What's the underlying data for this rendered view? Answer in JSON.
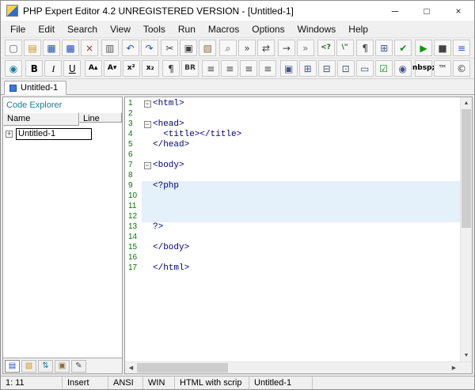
{
  "window": {
    "title": "PHP Expert Editor 4.2 UNREGISTERED VERSION - [Untitled-1]",
    "controls": {
      "minimize": "─",
      "maximize": "□",
      "close": "×"
    }
  },
  "menu": {
    "items": [
      "File",
      "Edit",
      "Search",
      "View",
      "Tools",
      "Run",
      "Macros",
      "Options",
      "Windows",
      "Help"
    ]
  },
  "toolbar_main": {
    "icons": [
      {
        "name": "new-file",
        "glyph": "▢",
        "color": "#555555"
      },
      {
        "name": "open-folder",
        "glyph": "▤",
        "color": "#c8921a"
      },
      {
        "name": "save",
        "glyph": "▦",
        "color": "#2050c0"
      },
      {
        "name": "save-all",
        "glyph": "▩",
        "color": "#2050c0"
      },
      {
        "name": "close-file",
        "glyph": "×",
        "color": "#883333"
      },
      {
        "type": "sep"
      },
      {
        "name": "print",
        "glyph": "▥",
        "color": "#555555"
      },
      {
        "type": "sep"
      },
      {
        "name": "undo",
        "glyph": "↶",
        "color": "#2050c0"
      },
      {
        "name": "redo",
        "glyph": "↷",
        "color": "#2050c0"
      },
      {
        "type": "sep"
      },
      {
        "name": "cut",
        "glyph": "✂",
        "color": "#444444"
      },
      {
        "name": "copy",
        "glyph": "▣",
        "color": "#444444"
      },
      {
        "name": "paste",
        "glyph": "▧",
        "color": "#8a6d3b"
      },
      {
        "type": "sep"
      },
      {
        "name": "find",
        "glyph": "⌕",
        "color": "#444444"
      },
      {
        "name": "find-next",
        "glyph": "»",
        "color": "#444444"
      },
      {
        "name": "replace",
        "glyph": "⇄",
        "color": "#444444"
      },
      {
        "type": "sep"
      },
      {
        "name": "goto-line",
        "glyph": "→",
        "color": "#444444"
      },
      {
        "name": "more-commands",
        "glyph": "»",
        "color": "#777777"
      },
      {
        "type": "sep"
      },
      {
        "name": "php-open-tag",
        "glyph": "<?",
        "color": "#206020",
        "small": true
      },
      {
        "name": "escape-quote",
        "glyph": "\\\"",
        "color": "#206020",
        "small": true
      },
      {
        "type": "sep"
      },
      {
        "name": "special-chars",
        "glyph": "¶",
        "color": "#444444"
      },
      {
        "name": "insert-table",
        "glyph": "⊞",
        "color": "#445588"
      },
      {
        "name": "check-syntax",
        "glyph": "✔",
        "color": "#1a8a1a"
      },
      {
        "type": "sep"
      },
      {
        "name": "run-script",
        "glyph": "▶",
        "color": "#0a9a0a"
      },
      {
        "name": "stop-script",
        "glyph": "■",
        "color": "#444444"
      },
      {
        "name": "script-output",
        "glyph": "≡",
        "color": "#2050c0"
      }
    ]
  },
  "toolbar_format": {
    "icons": [
      {
        "name": "preview-browser",
        "glyph": "◉",
        "color": "#17809c"
      },
      {
        "type": "sep"
      },
      {
        "name": "bold",
        "glyph": "B",
        "color": "#000000",
        "bold": true
      },
      {
        "name": "italic",
        "glyph": "I",
        "color": "#000000",
        "italic": true
      },
      {
        "name": "underline",
        "glyph": "U",
        "color": "#000000",
        "underline": true
      },
      {
        "type": "sep"
      },
      {
        "name": "font-bigger",
        "glyph": "A▴",
        "color": "#000000",
        "small": true
      },
      {
        "name": "font-smaller",
        "glyph": "A▾",
        "color": "#000000",
        "small": true
      },
      {
        "name": "superscript",
        "glyph": "x²",
        "color": "#000000",
        "small": true
      },
      {
        "name": "subscript",
        "glyph": "x₂",
        "color": "#000000",
        "small": true
      },
      {
        "type": "sep"
      },
      {
        "name": "pilcrow",
        "glyph": "¶",
        "color": "#333333"
      },
      {
        "name": "line-break",
        "glyph": "BR",
        "color": "#333333",
        "small": true
      },
      {
        "type": "sep"
      },
      {
        "name": "align-left",
        "glyph": "≡",
        "color": "#444444"
      },
      {
        "name": "align-center",
        "glyph": "≡",
        "color": "#444444"
      },
      {
        "name": "align-right",
        "glyph": "≡",
        "color": "#444444"
      },
      {
        "name": "align-justify",
        "glyph": "≡",
        "color": "#444444"
      },
      {
        "type": "sep"
      },
      {
        "name": "insert-image",
        "glyph": "▣",
        "color": "#445588"
      },
      {
        "name": "table",
        "glyph": "⊞",
        "color": "#445588"
      },
      {
        "name": "table-row",
        "glyph": "⊟",
        "color": "#445588"
      },
      {
        "name": "table-cell",
        "glyph": "⊡",
        "color": "#445588"
      },
      {
        "name": "form",
        "glyph": "▭",
        "color": "#445588"
      },
      {
        "name": "checkbox",
        "glyph": "☑",
        "color": "#1a8a1a"
      },
      {
        "name": "radio-button",
        "glyph": "◉",
        "color": "#445588"
      },
      {
        "type": "sep"
      },
      {
        "name": "nbsp-entity",
        "glyph": "nbsp;",
        "color": "#000000",
        "small": true
      },
      {
        "name": "trademark-entity",
        "glyph": "™",
        "color": "#333333"
      },
      {
        "name": "copyright-entity",
        "glyph": "©",
        "color": "#333333"
      }
    ]
  },
  "tabbar": {
    "tabs": [
      {
        "label": "Untitled-1"
      }
    ]
  },
  "code_explorer": {
    "title": "Code Explorer",
    "columns": [
      "Name",
      "Line"
    ],
    "expander_glyph": "+",
    "rows": [
      {
        "name": "Untitled-1",
        "line": ""
      }
    ]
  },
  "left_panel_tabs": {
    "icons": [
      {
        "name": "code-explorer-panel",
        "glyph": "▤",
        "color": "#2050c0",
        "active": true
      },
      {
        "name": "file-browser-panel",
        "glyph": "▧",
        "color": "#c8921a"
      },
      {
        "name": "ftp-panel",
        "glyph": "⇅",
        "color": "#17809c"
      },
      {
        "name": "snippets-panel",
        "glyph": "▣",
        "color": "#8a6d3b"
      },
      {
        "name": "todo-panel",
        "glyph": "✎",
        "color": "#444444"
      }
    ]
  },
  "editor": {
    "fold_glyph": "−",
    "colors": {
      "tag": "#000080",
      "line_number": "#007a00",
      "highlight": "#e4f0fa"
    },
    "lines": [
      {
        "n": "1",
        "text": "<html>",
        "fold": true,
        "hl": false
      },
      {
        "n": "2",
        "text": "",
        "fold": false,
        "hl": false
      },
      {
        "n": "3",
        "text": "<head>",
        "fold": true,
        "hl": false
      },
      {
        "n": "4",
        "text": "  <title></title>",
        "fold": false,
        "hl": false
      },
      {
        "n": "5",
        "text": "</head>",
        "fold": false,
        "hl": false
      },
      {
        "n": "6",
        "text": "",
        "fold": false,
        "hl": false
      },
      {
        "n": "7",
        "text": "<body>",
        "fold": true,
        "hl": false
      },
      {
        "n": "8",
        "text": "",
        "fold": false,
        "hl": false
      },
      {
        "n": "9",
        "text": "<?php",
        "fold": false,
        "hl": true
      },
      {
        "n": "10",
        "text": "",
        "fold": false,
        "hl": true
      },
      {
        "n": "11",
        "text": "",
        "fold": false,
        "hl": true
      },
      {
        "n": "12",
        "text": "",
        "fold": false,
        "hl": true
      },
      {
        "n": "13",
        "text": "?>",
        "fold": false,
        "hl": false
      },
      {
        "n": "14",
        "text": "",
        "fold": false,
        "hl": false
      },
      {
        "n": "15",
        "text": "</body>",
        "fold": false,
        "hl": false
      },
      {
        "n": "16",
        "text": "",
        "fold": false,
        "hl": false
      },
      {
        "n": "17",
        "text": "</html>",
        "fold": false,
        "hl": false
      }
    ]
  },
  "scrollbars": {
    "up": "▲",
    "down": "▼",
    "left": "◀",
    "right": "▶"
  },
  "status_bar": {
    "cells": [
      {
        "name": "caret-position",
        "text": "1: 11"
      },
      {
        "name": "insert-mode",
        "text": "Insert"
      },
      {
        "name": "encoding",
        "text": "ANSI"
      },
      {
        "name": "line-ending",
        "text": "WIN"
      },
      {
        "name": "syntax-mode",
        "text": "HTML with scrip"
      },
      {
        "name": "file-name",
        "text": "Untitled-1"
      }
    ]
  }
}
